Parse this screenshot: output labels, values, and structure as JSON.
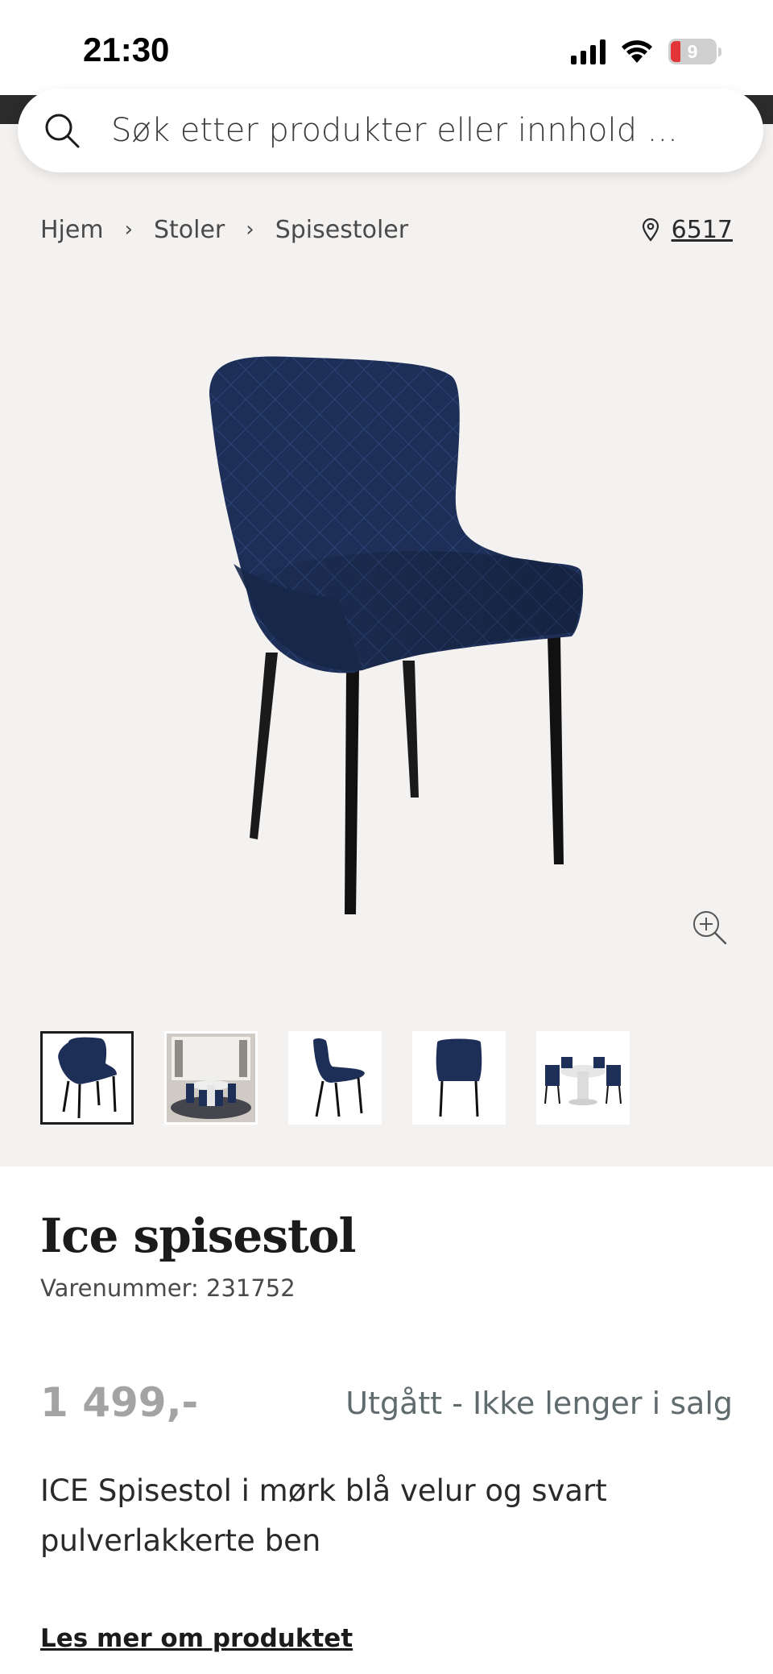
{
  "status_bar": {
    "time": "21:30",
    "battery_level": "9",
    "icons": [
      "signal-icon",
      "wifi-icon",
      "battery-icon"
    ]
  },
  "search": {
    "placeholder": "Søk etter produkter eller innhold ..."
  },
  "breadcrumb": {
    "items": [
      "Hjem",
      "Stoler",
      "Spisestoler"
    ]
  },
  "store": {
    "code": "6517"
  },
  "product": {
    "title": "Ice spisestol",
    "sku": "Varenummer: 231752",
    "price": "1 499,-",
    "availability": "Utgått - Ikke lenger i salg",
    "description": "ICE Spisestol i mørk blå velur og svart pulverlakkerte ben",
    "read_more": "Les mer om produktet"
  },
  "gallery": {
    "thumbnail_count": 5,
    "selected_index": 0
  },
  "colors": {
    "gallery_background": "#f4f2f0",
    "chair_velvet": "#1d2f57",
    "availability_text": "#5f6b6c",
    "price_text": "#a3a3a3"
  }
}
